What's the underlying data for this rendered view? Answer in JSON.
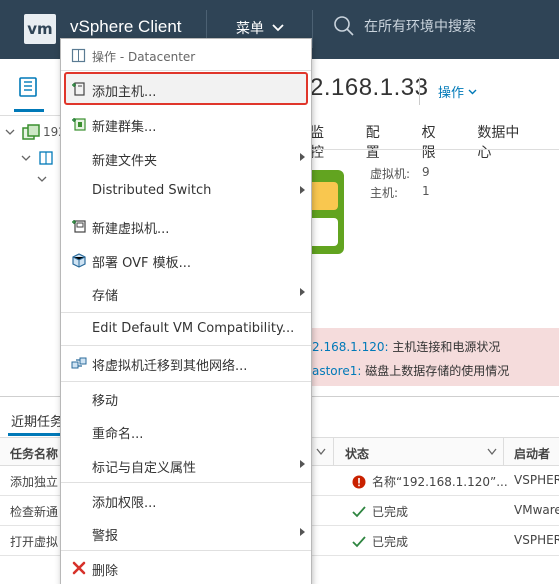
{
  "header": {
    "logo": "vm",
    "title": "vSphere Client",
    "menu_label": "菜单",
    "search_placeholder": "在所有环境中搜索"
  },
  "tree": {
    "root_label": "192"
  },
  "object": {
    "title": "2.168.1.33",
    "actions_label": "操作"
  },
  "tabs": [
    "监控",
    "配置",
    "权限",
    "数据中心"
  ],
  "stats": [
    {
      "label": "虚拟机:",
      "value": "9"
    },
    {
      "label": "主机:",
      "value": "1"
    }
  ],
  "alerts": [
    {
      "link": "2.168.1.120:",
      "text": " 主机连接和电源状况"
    },
    {
      "link": "astore1:",
      "text": " 磁盘上数据存储的使用情况"
    }
  ],
  "tasks": {
    "tab_label": "近期任务",
    "headers": [
      "任务名称",
      "状态",
      "启动者"
    ],
    "rows": [
      {
        "name": "添加独立",
        "status": "名称“192.168.1.120”...",
        "status_type": "error",
        "initiator": "VSPHER"
      },
      {
        "name": "检查新通",
        "status": "已完成",
        "status_type": "ok",
        "initiator": "VMware"
      },
      {
        "name": "打开虚拟",
        "status": "已完成",
        "status_type": "ok",
        "initiator": "VSPHER"
      }
    ]
  },
  "context_menu": {
    "header": "操作 - Datacenter",
    "items": [
      {
        "label": "添加主机...",
        "icon": "add-host-icon",
        "submenu": false
      },
      {
        "label": "新建群集...",
        "icon": "new-cluster-icon",
        "submenu": false
      },
      {
        "label": "新建文件夹",
        "icon": "",
        "submenu": true
      },
      {
        "label": "Distributed Switch",
        "icon": "",
        "submenu": true
      },
      {
        "label": "新建虚拟机...",
        "icon": "new-vm-icon",
        "submenu": false
      },
      {
        "label": "部署 OVF 模板...",
        "icon": "deploy-ovf-icon",
        "submenu": false
      },
      {
        "label": "存储",
        "icon": "",
        "submenu": true
      },
      {
        "label": "Edit Default VM Compatibility...",
        "icon": "",
        "submenu": false
      },
      {
        "label": "将虚拟机迁移到其他网络...",
        "icon": "migrate-network-icon",
        "submenu": false
      },
      {
        "label": "移动",
        "icon": "",
        "submenu": false
      },
      {
        "label": "重命名...",
        "icon": "",
        "submenu": false
      },
      {
        "label": "标记与自定义属性",
        "icon": "",
        "submenu": true
      },
      {
        "label": "添加权限...",
        "icon": "",
        "submenu": false
      },
      {
        "label": "警报",
        "icon": "",
        "submenu": true
      },
      {
        "label": "删除",
        "icon": "delete-icon",
        "submenu": false
      }
    ]
  },
  "colors": {
    "header_bg": "#2f4456",
    "accent": "#0079b8",
    "highlight": "#e0362b",
    "success": "#2e8540",
    "error": "#c92100"
  }
}
